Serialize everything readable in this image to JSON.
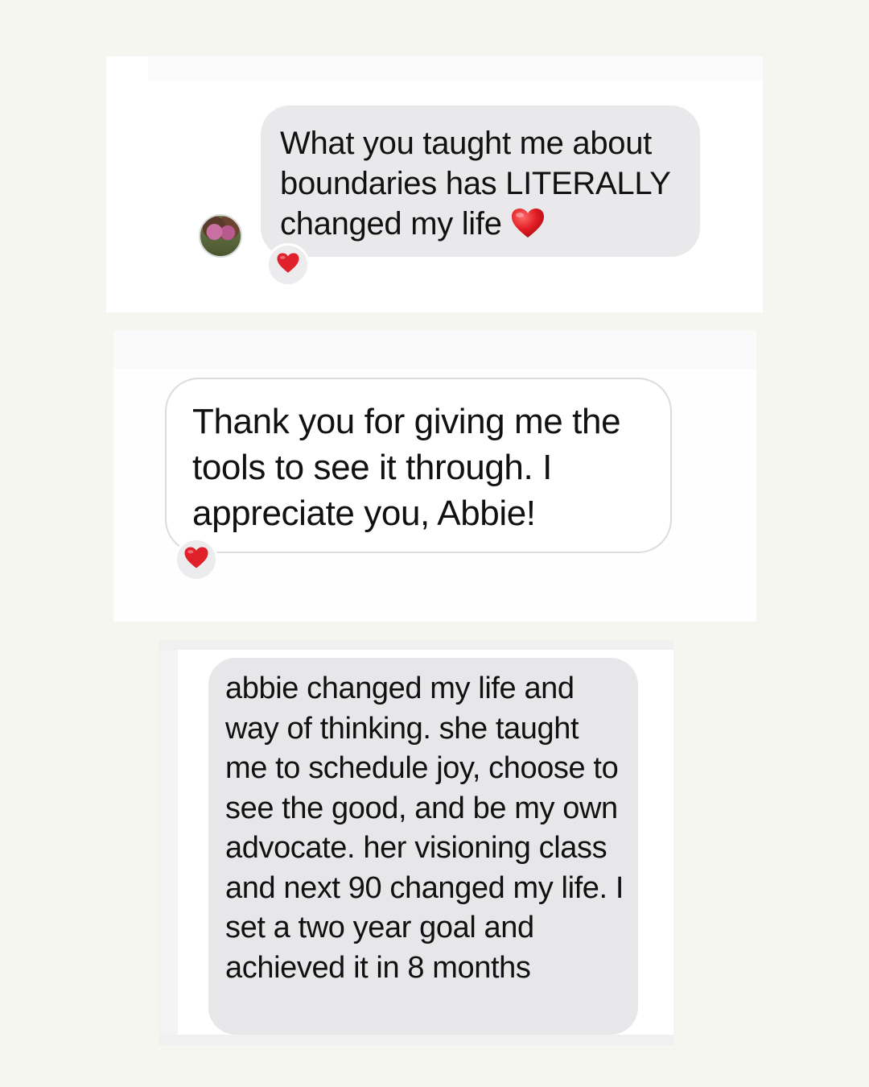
{
  "messages": [
    {
      "text": "What you taught me about boundaries has LITERALLY changed my life",
      "inline_emoji": "heart-icon",
      "reaction": "heart-icon"
    },
    {
      "text": "Thank you for giving me the tools to see it through. I appreciate you, Abbie!",
      "reaction": "heart-icon"
    },
    {
      "text": "abbie changed my life and way of thinking. she taught me to schedule joy, choose to see the good, and be my own advocate. her visioning class and next 90 changed my life. I set a two year goal and achieved it in 8 months"
    }
  ],
  "colors": {
    "page_background": "#f6f6f1",
    "card_background": "#ffffff",
    "received_bubble": "#e9e9eb",
    "outlined_bubble_border": "#dcdcdc",
    "heart": "#e0202a"
  }
}
